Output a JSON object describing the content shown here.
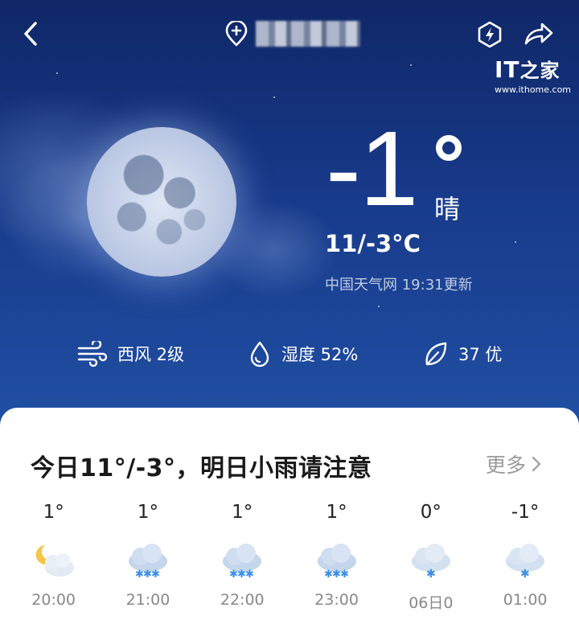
{
  "header": {
    "back_icon": "chevron-left-icon",
    "location_icon": "location-add-icon",
    "action_icons": [
      "bolt-badge-icon",
      "share-icon"
    ]
  },
  "watermark": {
    "logo_text": "IT之家",
    "url": "www.ithome.com"
  },
  "current": {
    "temperature": "-1",
    "condition": "晴",
    "range": "11/-3°C",
    "source": "中国天气网 19:31更新"
  },
  "stats": {
    "wind": "西风 2级",
    "humidity": "湿度 52%",
    "aqi": "37 优"
  },
  "forecast_card": {
    "title": "今日11°/-3°，明日小雨请注意",
    "more_label": "更多"
  },
  "hourly": [
    {
      "temp": "1°",
      "time": "20:00",
      "icon": "moon-cloud-icon"
    },
    {
      "temp": "1°",
      "time": "21:00",
      "icon": "snow-cloud-icon"
    },
    {
      "temp": "1°",
      "time": "22:00",
      "icon": "snow-cloud-icon"
    },
    {
      "temp": "1°",
      "time": "23:00",
      "icon": "snow-cloud-icon"
    },
    {
      "temp": "0°",
      "time": "06日0",
      "icon": "light-snow-cloud-icon"
    },
    {
      "temp": "-1°",
      "time": "01:00",
      "icon": "light-snow-cloud-icon"
    }
  ],
  "colors": {
    "sky_top": "#0f2767",
    "sky_bottom": "#2050a4",
    "card_bg": "#ffffff",
    "muted_text": "#888888"
  }
}
